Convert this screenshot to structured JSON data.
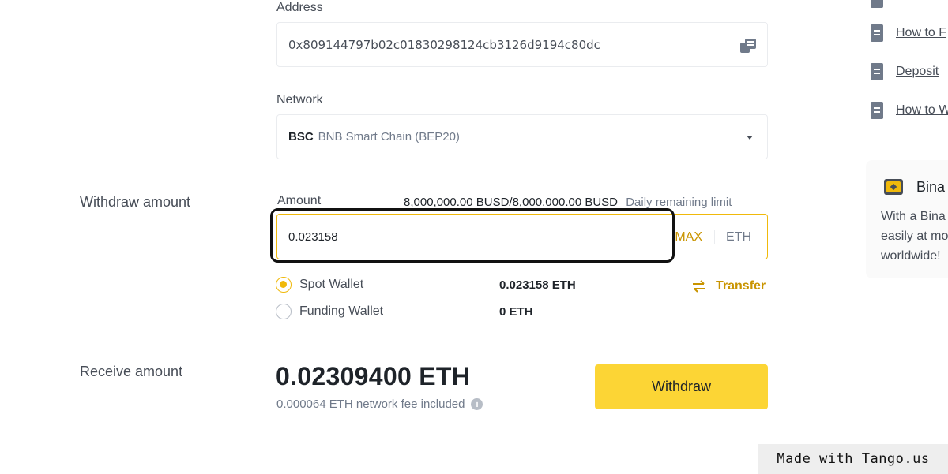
{
  "address": {
    "label": "Address",
    "value": "0x809144797b02c01830298124cb3126d9194c80dc",
    "copy_icon": "paste-icon"
  },
  "network": {
    "label": "Network",
    "code": "BSC",
    "name": "BNB Smart Chain (BEP20)"
  },
  "withdraw_amount": {
    "section_label": "Withdraw amount",
    "amount_label": "Amount",
    "limit_values": "8,000,000.00 BUSD/8,000,000.00 BUSD",
    "limit_label": "Daily remaining limit",
    "input_value": "0.023158",
    "max_label": "MAX",
    "unit": "ETH"
  },
  "wallets": [
    {
      "label": "Spot Wallet",
      "balance": "0.023158 ETH",
      "selected": true
    },
    {
      "label": "Funding Wallet",
      "balance": "0 ETH",
      "selected": false
    }
  ],
  "transfer_label": "Transfer",
  "receive": {
    "section_label": "Receive amount",
    "value": "0.02309400 ETH",
    "fee": "0.000064 ETH network fee included"
  },
  "withdraw_button": "Withdraw",
  "right_links": [
    "How to F",
    "Deposit",
    "How to W"
  ],
  "promo": {
    "title": "Bina",
    "lines": [
      "With a Bina",
      "easily at mo",
      "worldwide!"
    ]
  },
  "watermark": "Made with Tango.us",
  "colors": {
    "accent": "#f0b90b",
    "button": "#fcd535",
    "link_gold": "#c99400"
  }
}
